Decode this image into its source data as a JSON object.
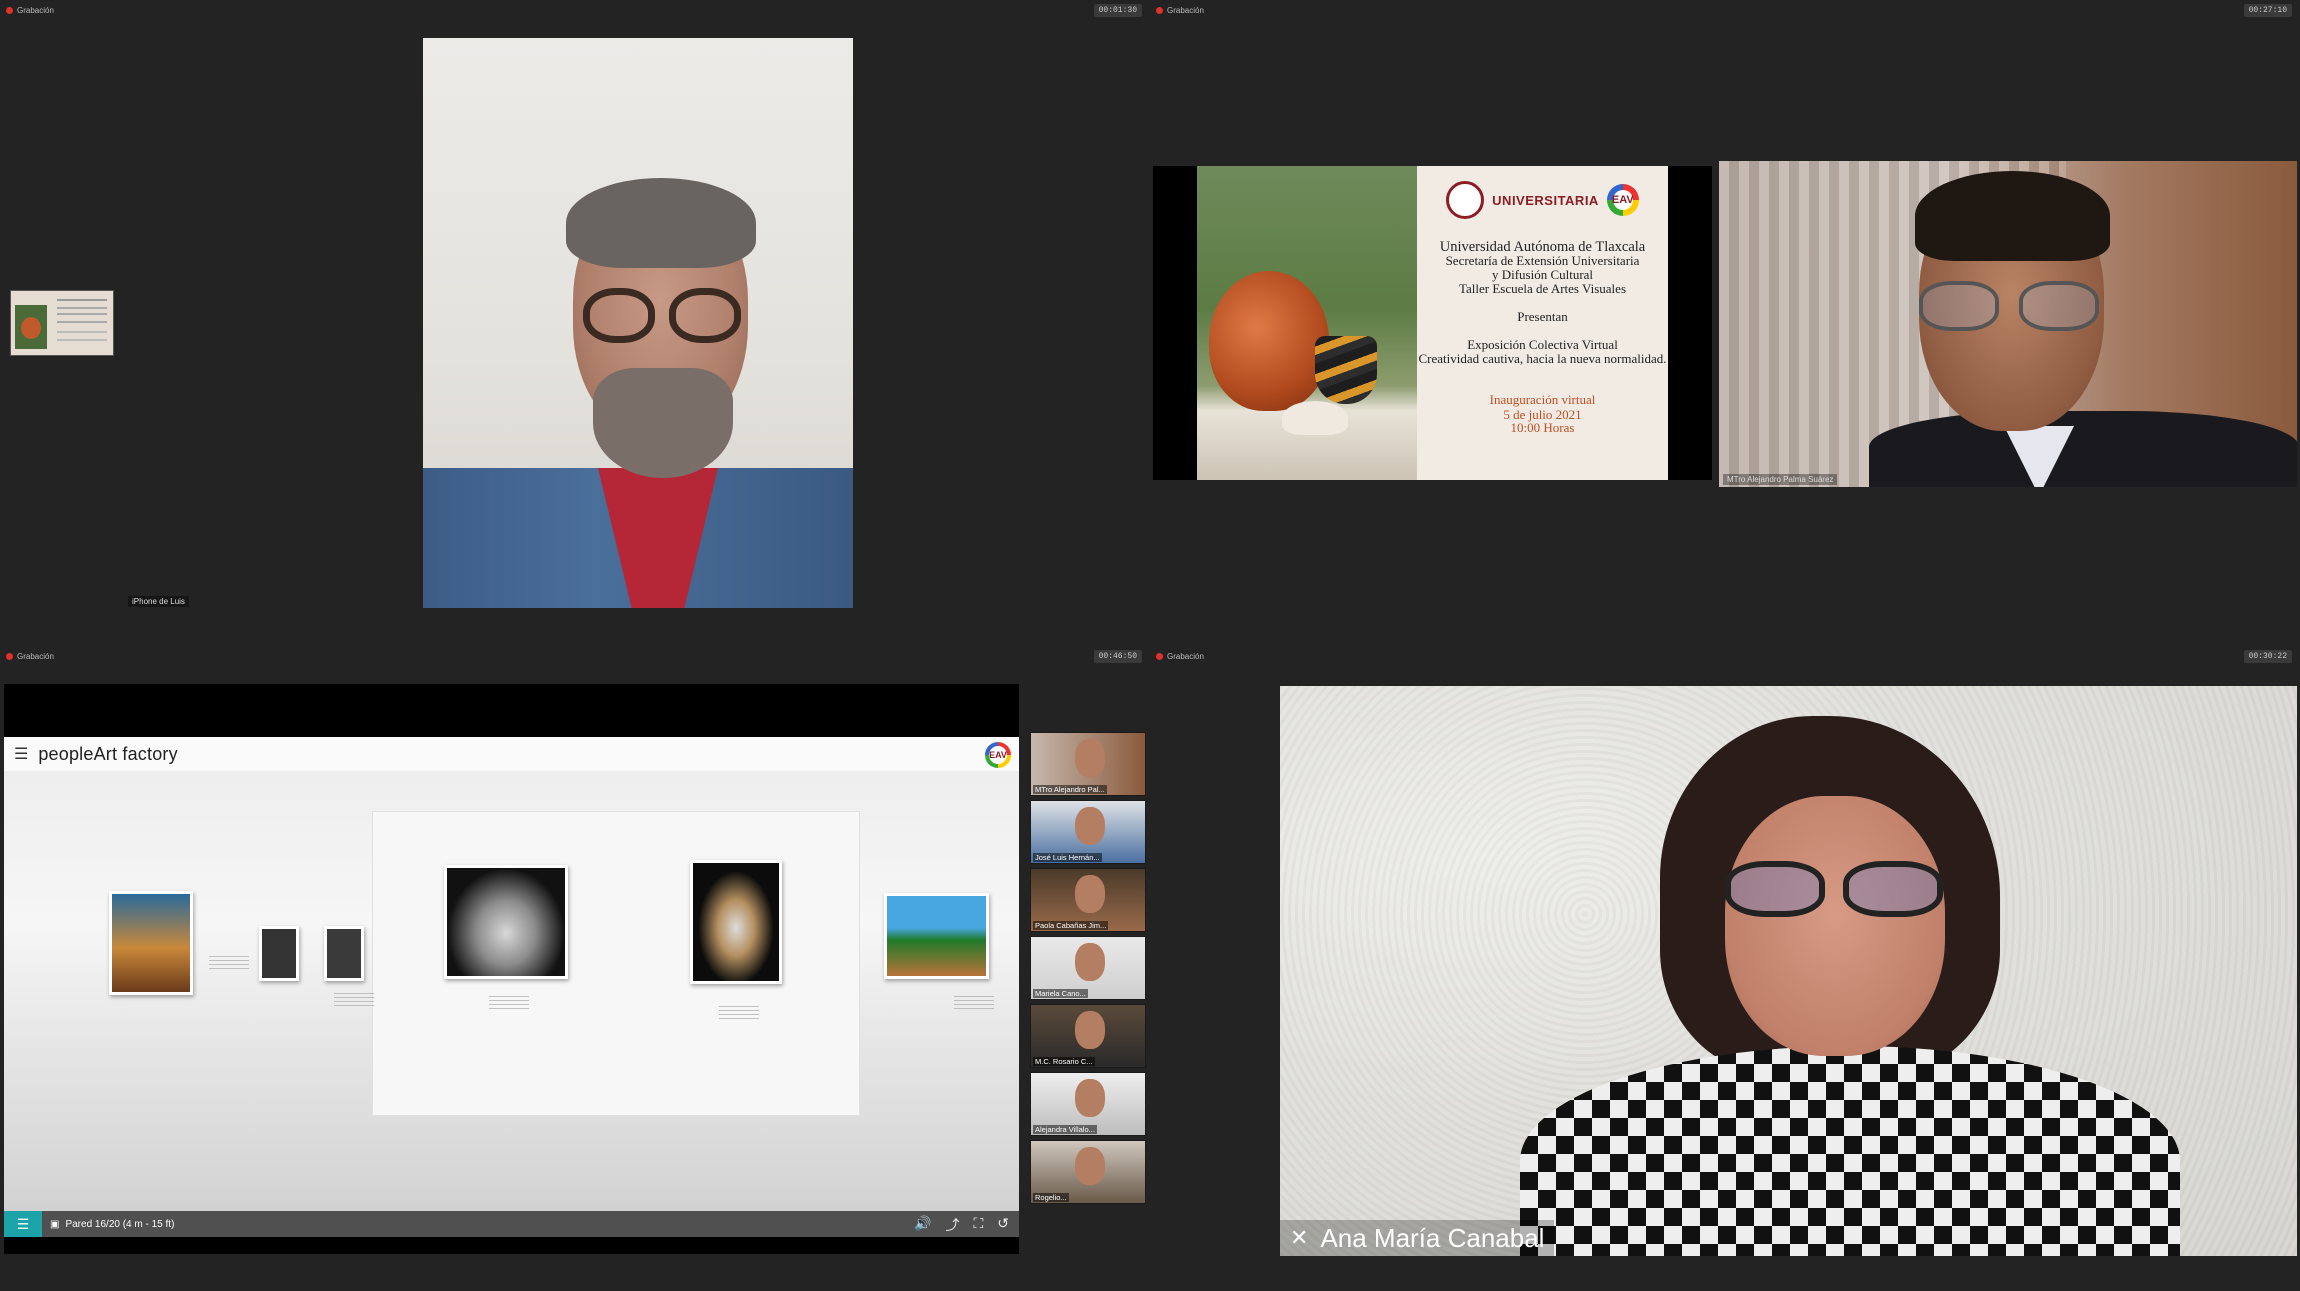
{
  "recording_label": "Grabación",
  "quadrants": [
    {
      "timer": "00:01:30",
      "speaker_name": "iPhone de Luis"
    },
    {
      "timer": "00:27:10",
      "speaker_name": "MTro Alejandro Palma Suárez"
    },
    {
      "timer": "00:46:50"
    },
    {
      "timer": "00:30:22",
      "speaker_name": "Ana María Canabal"
    }
  ],
  "slide": {
    "uni_wordmark": "UNIVERSITARIA",
    "badge_text": "EAV",
    "lines": [
      "Universidad Autónoma de Tlaxcala",
      "Secretaría de Extensión Universitaria",
      "y Difusión Cultural",
      "Taller Escuela de Artes Visuales"
    ],
    "presentan": "Presentan",
    "exposicion": "Exposición Colectiva Virtual",
    "tema": "Creatividad cautiva, hacia la nueva normalidad.",
    "inauguracion": "Inauguración virtual",
    "fecha": "5 de julio 2021",
    "hora": "10:00 Horas"
  },
  "share": {
    "app_title": "peopleArt factory",
    "logo_text": "EAV",
    "status": "Pared 16/20 (4 m - 15 ft)"
  },
  "gallery_participants": [
    "MTro Alejandro Pal...",
    "José Luis Hernán...",
    "Paola Cabañas Jim...",
    "Mariela Cano...",
    "M.C. Rosario C...",
    "Alejandra Villalo...",
    "Rogelio..."
  ],
  "colors": {
    "accent_teal": "#1ba3a8",
    "record_red": "#e0312d",
    "uni_maroon": "#8c1d24",
    "inaug_orange": "#c04f23"
  }
}
